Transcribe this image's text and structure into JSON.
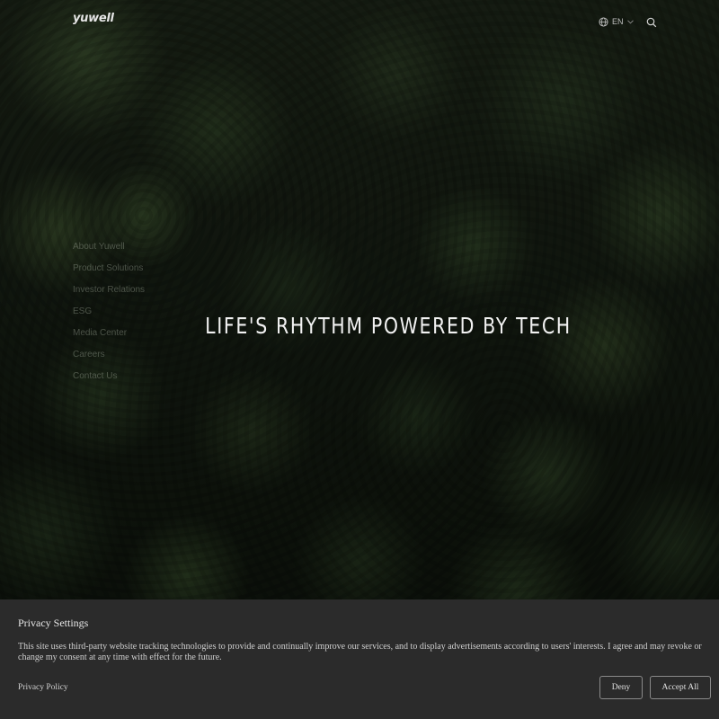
{
  "header": {
    "logo_text": "yuwell",
    "language": "EN",
    "icons": {
      "globe": "globe-icon",
      "chevron": "chevron-down-icon",
      "search": "search-icon"
    }
  },
  "side_nav": {
    "items": [
      {
        "label": "About Yuwell"
      },
      {
        "label": "Product Solutions"
      },
      {
        "label": "Investor Relations"
      },
      {
        "label": "ESG"
      },
      {
        "label": "Media Center"
      },
      {
        "label": "Careers"
      },
      {
        "label": "Contact Us"
      }
    ]
  },
  "hero": {
    "tagline": "LIFE'S RHYTHM POWERED BY TECH"
  },
  "privacy": {
    "title": "Privacy Settings",
    "text": "This site uses third-party website tracking technologies to provide and continually improve our services, and to display advertisements according to users' interests. I agree and may revoke or change my consent at any time with effect for the future.",
    "link_label": "Privacy Policy",
    "deny_label": "Deny",
    "accept_label": "Accept All"
  },
  "colors": {
    "banner_bg": "#2b2b2b",
    "hero_bg": "#141b12",
    "text_light": "#f2f2f2"
  }
}
